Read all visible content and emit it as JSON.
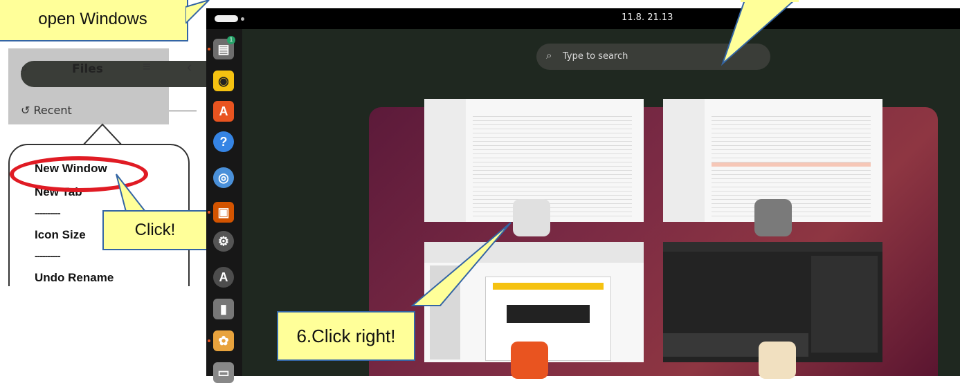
{
  "tutorial": {
    "top_callout": "open Windows",
    "files_panel": {
      "title": "Files",
      "recent_label": "Recent"
    },
    "menu_items": [
      "New Window",
      "New Tab",
      "----------",
      "Icon Size",
      "----------",
      "Undo Rename"
    ],
    "click_callout": "Click!",
    "click_right_callout": "6.Click right!"
  },
  "topbar": {
    "clock": "11.8.  21.13"
  },
  "search": {
    "placeholder": "Type to search"
  },
  "colors": {
    "accent": "#e95420",
    "callout_fill": "#ffff99",
    "callout_border": "#3465a4",
    "highlight_ring": "#e01b24"
  },
  "dock_apps": [
    {
      "name": "files-icon",
      "glyph": "▤",
      "color": "#6d6d6d"
    },
    {
      "name": "rhythmbox-icon",
      "glyph": "◉",
      "color": "#f5c211"
    },
    {
      "name": "app-center-icon",
      "glyph": "A",
      "color": "#e95420"
    },
    {
      "name": "help-icon",
      "glyph": "?",
      "color": "#3584e4"
    },
    {
      "name": "chromium-icon",
      "glyph": "◎",
      "color": "#4a90d9"
    },
    {
      "name": "impress-icon",
      "glyph": "▣",
      "color": "#d35400"
    },
    {
      "name": "settings-icon",
      "glyph": "⚙",
      "color": "#555555"
    },
    {
      "name": "software-updater-icon",
      "glyph": "A",
      "color": "#4d4d4d"
    },
    {
      "name": "usb-drive-icon",
      "glyph": "▮",
      "color": "#777777"
    },
    {
      "name": "image-viewer-icon",
      "glyph": "✿",
      "color": "#e8a33d"
    },
    {
      "name": "trash-icon",
      "glyph": "▭",
      "color": "#888888"
    }
  ]
}
